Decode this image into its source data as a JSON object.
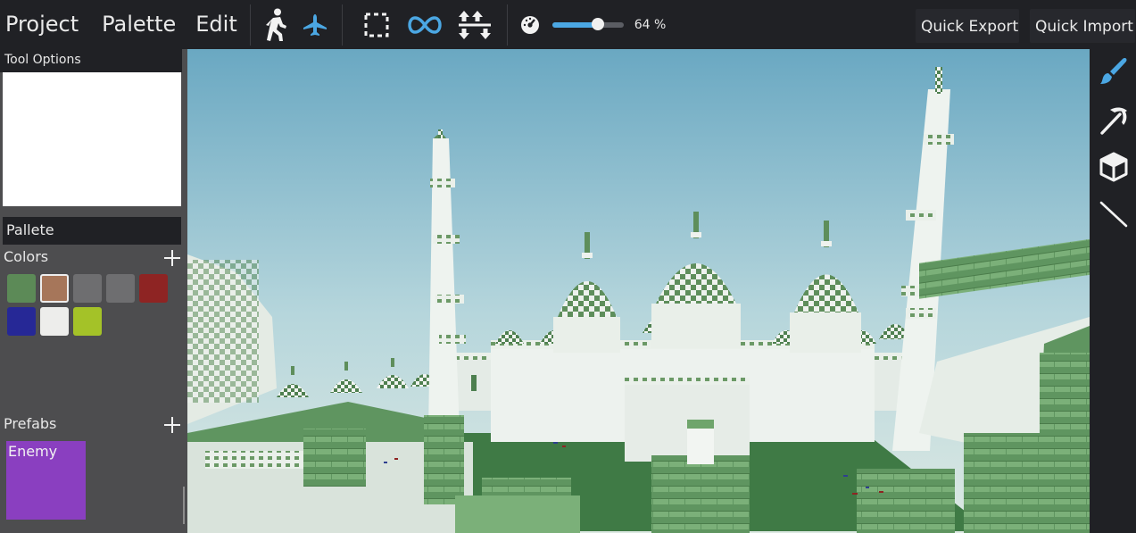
{
  "menubar": {
    "project": "Project",
    "palette": "Palette",
    "edit": "Edit"
  },
  "toolbar": {
    "tools": [
      {
        "icon": "walk-icon",
        "active": false
      },
      {
        "icon": "fly-icon",
        "active": true
      },
      {
        "icon": "selection-icon",
        "active": false
      },
      {
        "icon": "infinity-icon",
        "active": true
      },
      {
        "icon": "vertical-arrows-icon",
        "active": false
      }
    ],
    "speed_icon": "speedometer-icon",
    "zoom_value": 64,
    "zoom_label": "64 %",
    "quick_export": "Quick Export",
    "quick_import": "Quick Import"
  },
  "left_panel": {
    "tool_options_title": "Tool Options",
    "pallete_title": "Pallete",
    "colors_label": "Colors",
    "colors": [
      "#5c8a57",
      "#a6765a",
      "#6e6e70",
      "#6e6e70",
      "#8e2423",
      "#262896",
      "#ededeb",
      "#a4c228"
    ],
    "selected_color_index": 1,
    "prefabs_label": "Prefabs",
    "prefabs": [
      {
        "name": "Enemy",
        "color": "#8a3fc0"
      }
    ]
  },
  "right_toolbar": {
    "tools": [
      {
        "icon": "paint-brush-icon",
        "active": true
      },
      {
        "icon": "pickaxe-icon",
        "active": false
      },
      {
        "icon": "cube-icon",
        "active": false
      },
      {
        "icon": "line-icon",
        "active": false
      }
    ]
  },
  "colors": {
    "accent": "#4ba7e3",
    "panel": "#4d4d4f",
    "topbar": "#202125"
  }
}
